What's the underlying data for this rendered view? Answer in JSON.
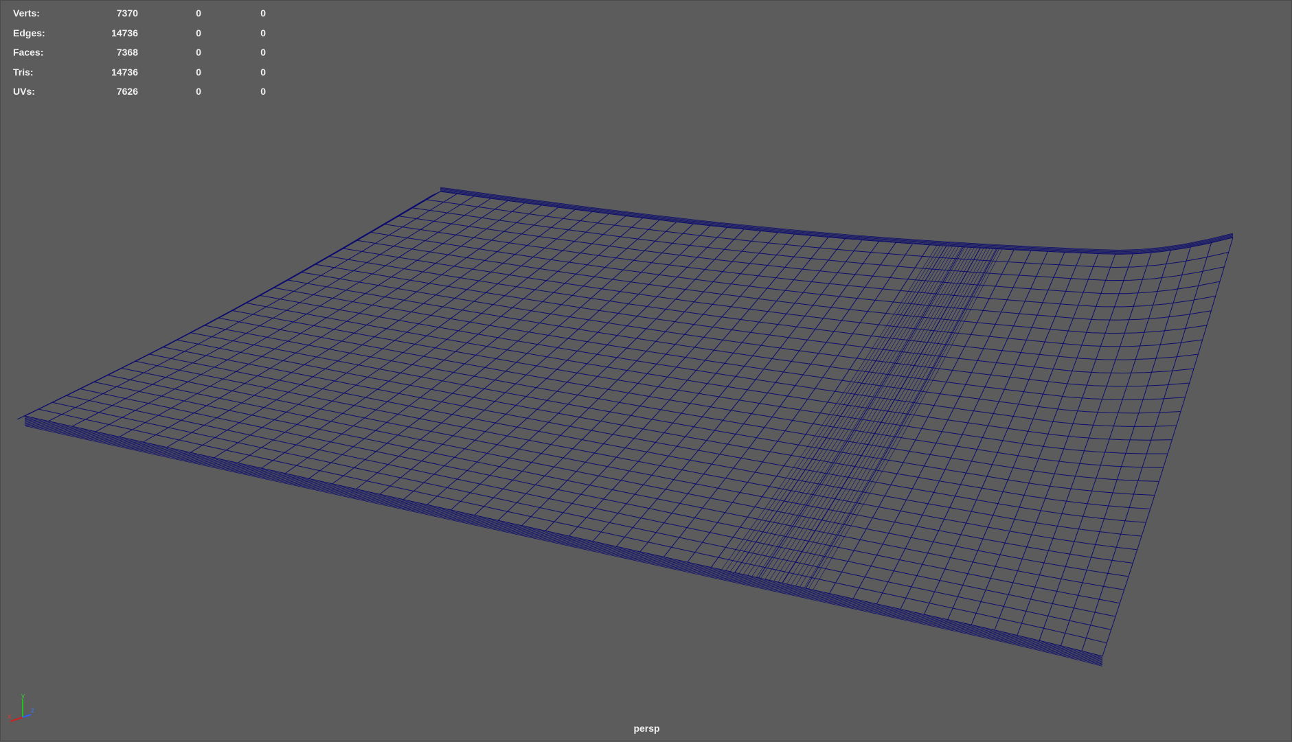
{
  "hud": {
    "rows": [
      {
        "label": "Verts:",
        "total": "7370",
        "selected": "0",
        "selected2": "0"
      },
      {
        "label": "Edges:",
        "total": "14736",
        "selected": "0",
        "selected2": "0"
      },
      {
        "label": "Faces:",
        "total": "7368",
        "selected": "0",
        "selected2": "0"
      },
      {
        "label": "Tris:",
        "total": "14736",
        "selected": "0",
        "selected2": "0"
      },
      {
        "label": "UVs:",
        "total": "7626",
        "selected": "0",
        "selected2": "0"
      }
    ]
  },
  "viewport": {
    "camera": "persp",
    "background_color": "#5c5c5c",
    "wire_color": "#0d0d6e"
  },
  "axis": {
    "x": "x",
    "y": "y",
    "z": "z"
  }
}
